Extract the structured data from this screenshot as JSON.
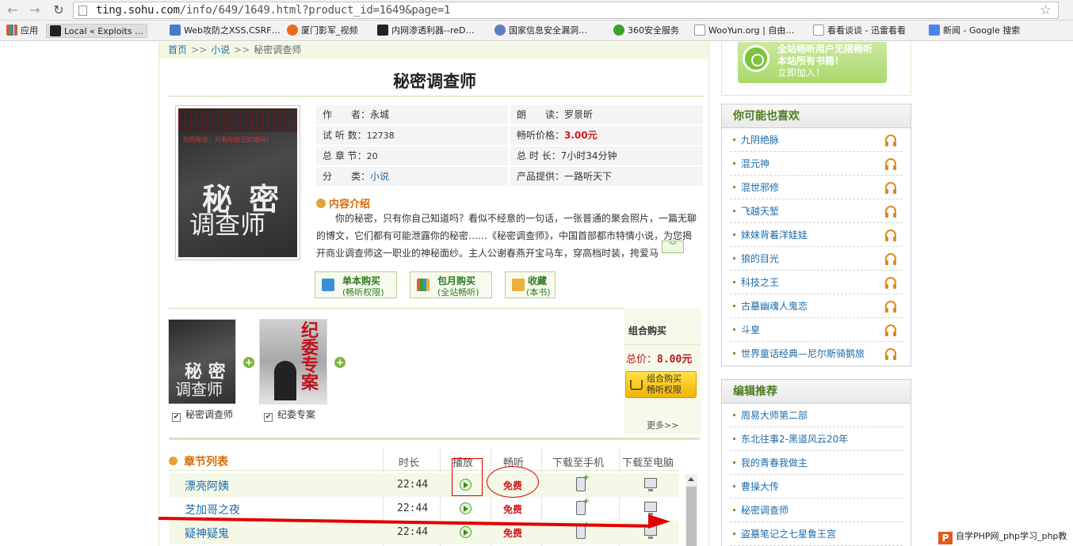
{
  "browser": {
    "url_domain": "ting.sohu.com",
    "url_path": "/info/649/1649.html?product_id=1649&page=1",
    "nav": {
      "back": "←",
      "forward": "→",
      "reload": "↻",
      "star": "☆"
    }
  },
  "bookmarks": [
    {
      "label": "应用",
      "color": "#d9544f"
    },
    {
      "label": "Local « Exploits …",
      "color": "#222222"
    },
    {
      "label": "Web攻防之XSS,CSRF…",
      "color": "#4a7bc8"
    },
    {
      "label": "厦门影军_视频",
      "color": "#e86a1a"
    },
    {
      "label": "内网渗透利器--reD…",
      "color": "#222222"
    },
    {
      "label": "国家信息安全漏洞…",
      "color": "#5a7fbf"
    },
    {
      "label": "360安全服务",
      "color": "#3aa02a"
    },
    {
      "label": "WooYun.org | 自由…",
      "color": "#dddddd"
    },
    {
      "label": "看看谈谈 - 迅雷看看",
      "color": "#dddddd"
    },
    {
      "label": "新闻 - Google 搜索",
      "color": "#4a86e8"
    }
  ],
  "breadcrumb": {
    "home": "首页",
    "sep": ">>",
    "cat": "小说",
    "current": "秘密调查师"
  },
  "book": {
    "title": "秘密调查师",
    "cover_tagline": "你的秘密，只有你自己知道吗？",
    "cover_big1": "秘 密",
    "cover_big2": "调查师",
    "info": {
      "author_label": "作　　者：",
      "author": "永城",
      "reader_label": "朗　　读：",
      "reader": "罗景昕",
      "trial_label": "试 听 数：",
      "trial": "12738",
      "price_label": "畅听价格：",
      "price": "3.00元",
      "chapters_label": "总 章 节：",
      "chapters": "20",
      "duration_label": "总 时 长：",
      "duration": "7小时34分钟",
      "category_label": "分　　类：",
      "category": "小说",
      "provider_label": "产品提供：",
      "provider": "一路听天下"
    },
    "intro_title": "内容介绍",
    "intro_text": "你的秘密，只有你自己知道吗？看似不经意的一句话，一张普通的聚会照片，一篇无聊的博文，它们都有可能泄露你的秘密……《秘密调查师》，中国首部都市特情小说，为您揭开商业调查师这一职业的神秘面纱。主人公谢春燕开宝马车，穿高档时装，挎爱马",
    "more_icon": "double-chevron-down"
  },
  "buy_buttons": [
    {
      "title": "单本购买",
      "sub": "(畅听权限)",
      "color": "#3b8fd6"
    },
    {
      "title": "包月购买",
      "sub": "(全站畅听)",
      "color": "#e25b3a"
    },
    {
      "title": "收藏",
      "sub": "(本书)",
      "color": "#e9b13a"
    }
  ],
  "combo": {
    "books": [
      "秘密调查师",
      "纪委专案"
    ],
    "book2_title": "纪委专案",
    "label": "组合购买",
    "total_label": "总价：",
    "total": "8.00元",
    "buy_line1": "组合购买",
    "buy_line2": "畅听权限",
    "more": "更多>>"
  },
  "chapters": {
    "title": "章节列表",
    "headers": [
      "时长",
      "播放",
      "畅听",
      "下载至手机",
      "下载至电脑"
    ],
    "rows": [
      {
        "name": "漂亮阿姨",
        "duration": "22:44",
        "listen": "免费"
      },
      {
        "name": "芝加哥之夜",
        "duration": "22:44",
        "listen": "免费"
      },
      {
        "name": "疑神疑鬼",
        "duration": "22:44",
        "listen": "免费"
      }
    ]
  },
  "sidebar": {
    "promo": {
      "line1": "全站畅听用户无限畅听",
      "line2": "本站所有书籍！",
      "line3": "立即加入！"
    },
    "likes_title": "你可能也喜欢",
    "likes": [
      "九阴绝脉",
      "混元神",
      "混世邪修",
      "飞越天堑",
      "妹妹背着洋娃娃",
      "狼的目光",
      "科技之王",
      "古墓幽魂人鬼恋",
      "斗皇",
      "世界童话经典—尼尔斯骑鹅旅"
    ],
    "editor_title": "编辑推荐",
    "editor": [
      "周易大师第二部",
      "东北往事2-黑道风云20年",
      "我的青春我做主",
      "曹操大传",
      "秘密调查师",
      "盗墓笔记之七星鲁王宫"
    ]
  },
  "watermark": {
    "logo": "P",
    "text": "自学PHP网_php学习_php教"
  }
}
